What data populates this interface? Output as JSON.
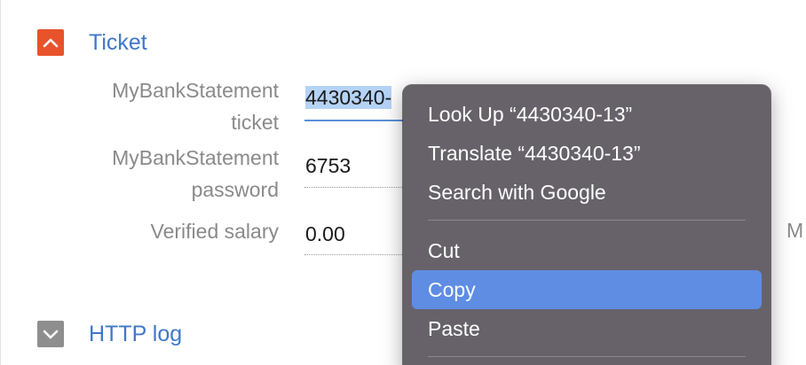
{
  "sections": {
    "ticket": {
      "title": "Ticket",
      "state": "expanded"
    },
    "http_log": {
      "title": "HTTP log",
      "state": "collapsed"
    }
  },
  "fields": [
    {
      "label_line1": "MyBankStatement",
      "label_line2": "ticket",
      "value": "4430340-"
    },
    {
      "label_line1": "MyBankStatement",
      "label_line2": "password",
      "value": "6753"
    },
    {
      "label_line1": "Verified salary",
      "value": "0.00"
    }
  ],
  "trailing_text": "M",
  "context_menu": {
    "items": [
      {
        "label": "Look Up “4430340-13”"
      },
      {
        "label": "Translate “4430340-13”"
      },
      {
        "label": "Search with Google"
      },
      {
        "label": "Cut"
      },
      {
        "label": "Copy",
        "highlighted": true
      },
      {
        "label": "Paste"
      }
    ]
  },
  "colors": {
    "accent_link": "#3f78c9",
    "expanded_toggle": "#e8532b",
    "collapsed_toggle": "#8e8e8e",
    "menu_background": "#67626a",
    "menu_highlight": "#5e8de3",
    "text_selection": "#b5d3f5"
  },
  "icons": {
    "expanded_toggle": "chevron-up-icon",
    "collapsed_toggle": "chevron-down-icon"
  }
}
